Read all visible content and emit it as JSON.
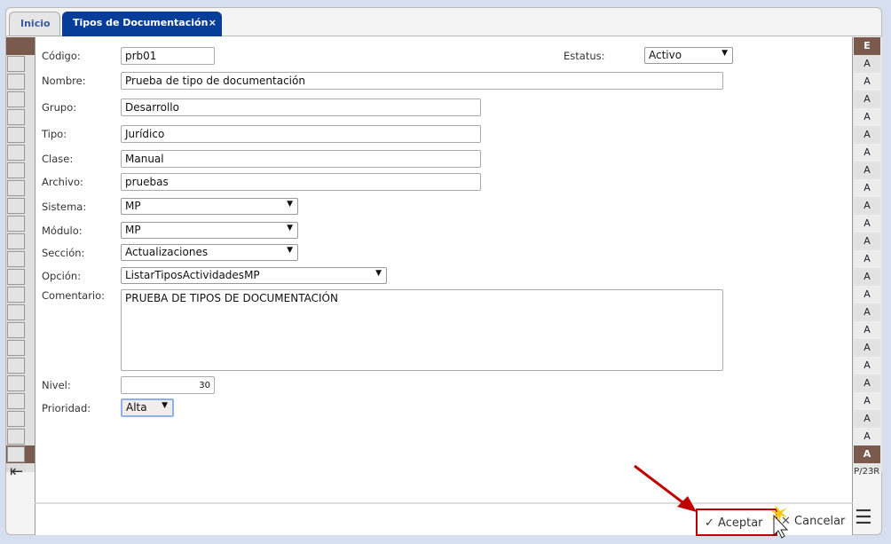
{
  "tabs": [
    {
      "label": "Inicio"
    },
    {
      "label": "Tipos de Documentación",
      "close": "×"
    }
  ],
  "form": {
    "codigo": {
      "label": "Código:",
      "value": "prb01"
    },
    "estatus": {
      "label": "Estatus:",
      "value": "Activo"
    },
    "nombre": {
      "label": "Nombre:",
      "value": "Prueba de tipo de documentación"
    },
    "grupo": {
      "label": "Grupo:",
      "value": "Desarrollo"
    },
    "tipo": {
      "label": "Tipo:",
      "value": "Jurídico"
    },
    "clase": {
      "label": "Clase:",
      "value": "Manual"
    },
    "archivo": {
      "label": "Archivo:",
      "value": "pruebas"
    },
    "sistema": {
      "label": "Sistema:",
      "value": "MP"
    },
    "modulo": {
      "label": "Módulo:",
      "value": "MP"
    },
    "seccion": {
      "label": "Sección:",
      "value": "Actualizaciones"
    },
    "opcion": {
      "label": "Opción:",
      "value": "ListarTiposActividadesMP"
    },
    "comentario": {
      "label": "Comentario:",
      "value": "PRUEBA DE TIPOS DE DOCUMENTACIÓN"
    },
    "nivel": {
      "label": "Nivel:",
      "value": "30"
    },
    "prioridad": {
      "label": "Prioridad:",
      "value": "Alta"
    }
  },
  "grid": {
    "right_header": "E",
    "cell_value": "A",
    "pager_text": ".P/23R"
  },
  "toolbar": {
    "accept": "Aceptar",
    "cancel": "Cancelar"
  },
  "colors": {
    "tab_active": "#063d99",
    "grid_header": "#7a5a4c",
    "highlight": "#c00000"
  }
}
